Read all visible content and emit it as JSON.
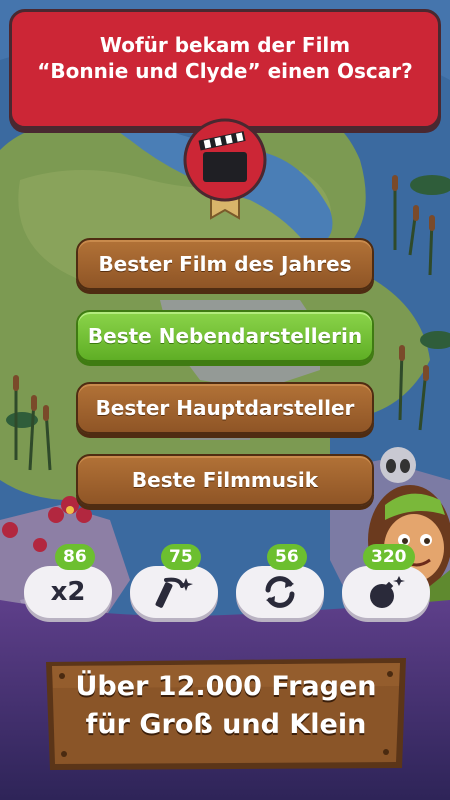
{
  "question": {
    "line1": "Wofür bekam der Film",
    "line2": "“Bonnie und Clyde” einen Oscar?"
  },
  "category": {
    "icon": "clapperboard-icon"
  },
  "answers": [
    {
      "label": "Bester Film des Jahres",
      "state": "default"
    },
    {
      "label": "Beste Nebendarstellerin",
      "state": "correct"
    },
    {
      "label": "Bester Hauptdarsteller",
      "state": "default"
    },
    {
      "label": "Beste Filmmusik",
      "state": "default"
    }
  ],
  "powerups": [
    {
      "count": "86",
      "label": "x2",
      "icon": "double-points"
    },
    {
      "count": "75",
      "icon": "magic-wand-icon"
    },
    {
      "count": "56",
      "icon": "refresh-icon"
    },
    {
      "count": "320",
      "icon": "bomb-icon"
    }
  ],
  "banner": {
    "line1": "Über 12.000 Fragen",
    "line2": "für Groß und Klein"
  },
  "colors": {
    "question_bg": "#cc2636",
    "answer_bg": "#9a5c2b",
    "correct_bg": "#6cbf2f",
    "count_badge": "#6cbf2f",
    "bottom_bg": "#3b2a6b"
  }
}
